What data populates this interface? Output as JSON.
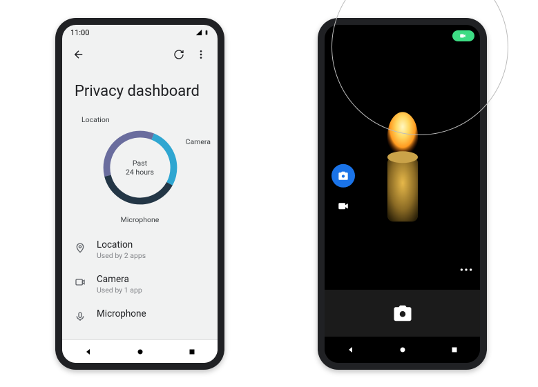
{
  "left": {
    "status_time": "11:00",
    "title": "Privacy dashboard",
    "chart": {
      "label_location": "Location",
      "label_camera": "Camera",
      "label_microphone": "Microphone",
      "center_line1": "Past",
      "center_line2": "24 hours"
    },
    "perms": [
      {
        "icon": "pin-icon",
        "title": "Location",
        "sub": "Used by 2 apps"
      },
      {
        "icon": "camera-icon",
        "title": "Camera",
        "sub": "Used by 1 app"
      },
      {
        "icon": "mic-icon",
        "title": "Microphone",
        "sub": ""
      }
    ]
  },
  "chart_data": {
    "type": "pie",
    "title": "Past 24 hours",
    "series": [
      {
        "name": "Location",
        "value": 35,
        "color": "#6a6d9e"
      },
      {
        "name": "Camera",
        "value": 27,
        "color": "#2fa6d1"
      },
      {
        "name": "Microphone",
        "value": 38,
        "color": "#233646"
      }
    ]
  },
  "right": {
    "indicator": "camera-active",
    "side_buttons": {
      "photo": "camera-icon",
      "video": "videocam-icon"
    },
    "shutter": "camera-icon",
    "more": "more-horiz-icon"
  }
}
